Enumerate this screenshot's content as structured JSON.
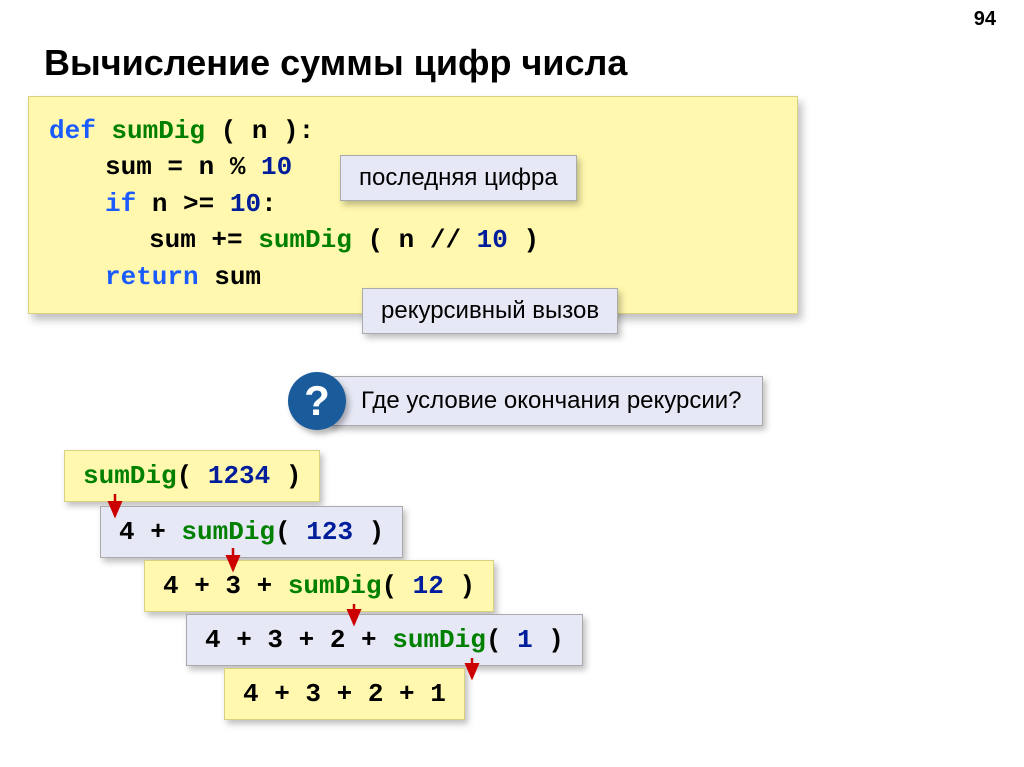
{
  "page_number": "94",
  "title": "Вычисление суммы цифр числа",
  "code": {
    "def": "def",
    "fname": "sumDig",
    "param_open": " ( n ):",
    "line2_a": "sum",
    "line2_b": " = n % ",
    "line2_c": "10",
    "if": "if",
    "cond": " n >= ",
    "ten": "10",
    "colon": ":",
    "line4_a": "sum += ",
    "line4_b": "sumDig",
    "line4_c": " ( n // ",
    "line4_d": "10",
    "line4_e": " )",
    "ret": "return",
    "ret_b": " sum"
  },
  "callouts": {
    "last_digit": "последняя цифра",
    "recursive_call": "рекурсивный вызов"
  },
  "question": {
    "mark": "?",
    "text": "Где условие окончания рекурсии?"
  },
  "steps": {
    "s1a": "sumDig",
    "s1b": "( ",
    "s1c": "1234",
    "s1d": " )",
    "s2a": "4 + ",
    "s2b": "sumDig",
    "s2c": "( ",
    "s2d": "123",
    "s2e": " )",
    "s3a": "4 + 3 + ",
    "s3b": "sumDig",
    "s3c": "( ",
    "s3d": "12",
    "s3e": " )",
    "s4a": "4 + 3 + 2 + ",
    "s4b": "sumDig",
    "s4c": "( ",
    "s4d": "1",
    "s4e": " )",
    "s5": "4 + 3 + 2 + 1"
  }
}
